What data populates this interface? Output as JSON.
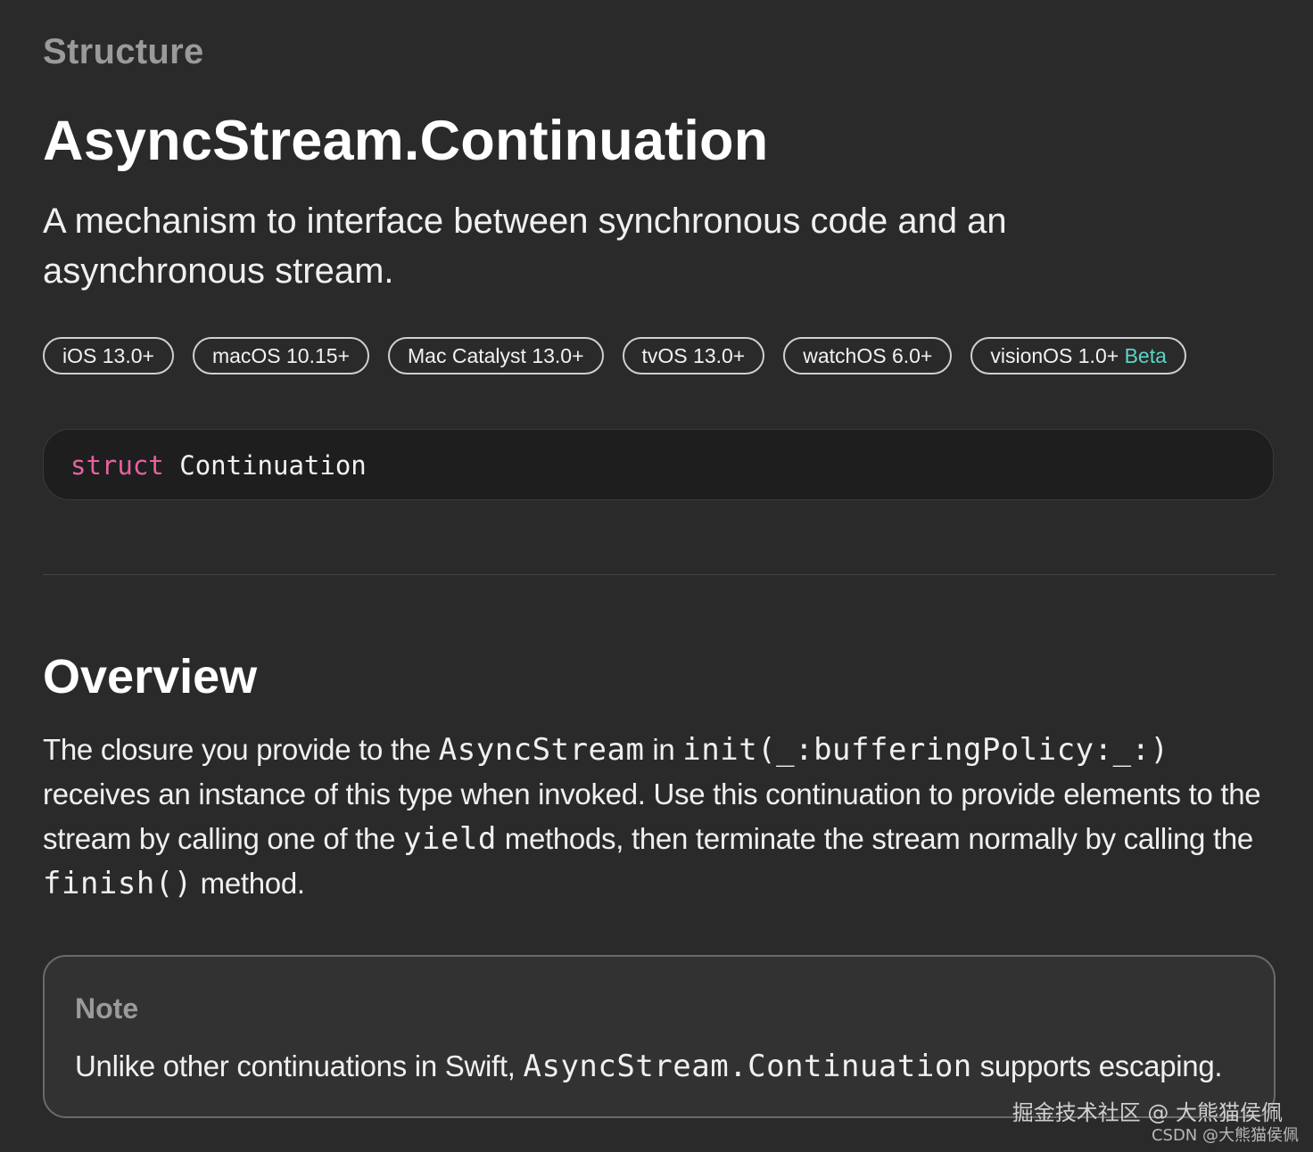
{
  "header": {
    "eyebrow": "Structure",
    "title": "AsyncStream.Continuation",
    "abstract": "A mechanism to interface between synchronous code and an asynchronous stream."
  },
  "platforms": [
    {
      "label": "iOS 13.0+"
    },
    {
      "label": "macOS 10.15+"
    },
    {
      "label": "Mac Catalyst 13.0+"
    },
    {
      "label": "tvOS 13.0+"
    },
    {
      "label": "watchOS 6.0+"
    },
    {
      "label": "visionOS 1.0+",
      "badge": "Beta"
    }
  ],
  "declaration": {
    "keyword": "struct",
    "name": "Continuation"
  },
  "overview": {
    "heading": "Overview",
    "text_1": "The closure you provide to the ",
    "code_1": "AsyncStream",
    "text_2": " in ",
    "code_2": "init(_:bufferingPolicy:_:)",
    "text_3": " receives an instance of this type when invoked. Use this continuation to provide elements to the stream by calling one of the ",
    "code_3": "yield",
    "text_4": " methods, then terminate the stream normally by calling the ",
    "code_4": "finish()",
    "text_5": " method."
  },
  "note": {
    "label": "Note",
    "text_1": "Unlike other continuations in Swift, ",
    "code_1": "AsyncStream.Continuation",
    "text_2": " supports escaping."
  },
  "watermark": {
    "line_1": "掘金技术社区 @ 大熊猫侯佩",
    "line_2": "CSDN @大熊猫侯佩"
  },
  "colors": {
    "background": "#2a2a2a",
    "keyword": "#e8619f",
    "beta": "#5fd3c6",
    "muted": "#9a9a9a"
  }
}
